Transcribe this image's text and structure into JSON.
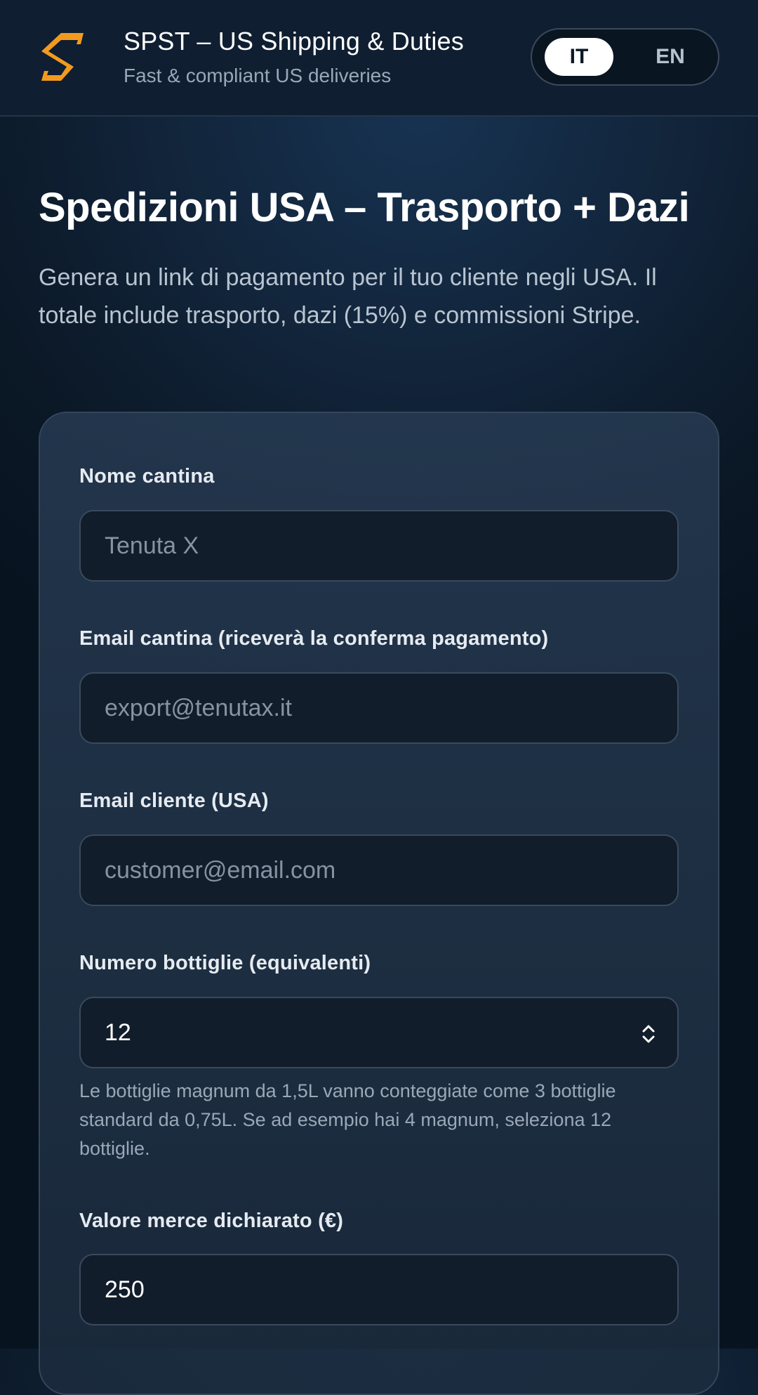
{
  "header": {
    "title": "SPST – US Shipping & Duties",
    "subtitle": "Fast & compliant US deliveries",
    "languages": [
      "IT",
      "EN"
    ],
    "active_language": "IT",
    "brand_color": "#f39a1e"
  },
  "main": {
    "title": "Spedizioni USA – Trasporto + Dazi",
    "intro": "Genera un link di pagamento per il tuo cliente negli USA. Il totale include trasporto, dazi (15%) e commissioni Stripe."
  },
  "form": {
    "winery_name": {
      "label": "Nome cantina",
      "placeholder": "Tenuta X",
      "value": ""
    },
    "winery_email": {
      "label": "Email cantina (riceverà la conferma pagamento)",
      "placeholder": "export@tenutax.it",
      "value": ""
    },
    "customer_email": {
      "label": "Email cliente (USA)",
      "placeholder": "customer@email.com",
      "value": ""
    },
    "bottles": {
      "label": "Numero bottiglie (equivalenti)",
      "value": "12",
      "help": "Le bottiglie magnum da 1,5L vanno conteggiate come 3 bottiglie standard da 0,75L. Se ad esempio hai 4 magnum, seleziona 12 bottiglie."
    },
    "declared_value": {
      "label": "Valore merce dichiarato (€)",
      "value": "250"
    }
  }
}
